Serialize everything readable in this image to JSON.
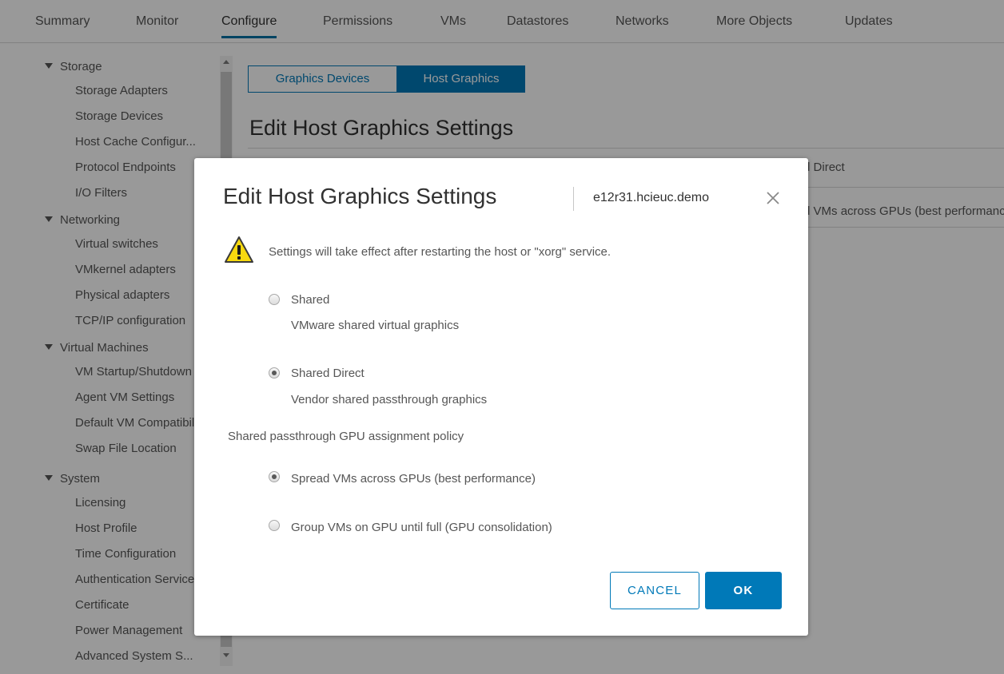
{
  "top_tabs": [
    {
      "label": "Summary"
    },
    {
      "label": "Monitor"
    },
    {
      "label": "Configure"
    },
    {
      "label": "Permissions"
    },
    {
      "label": "VMs"
    },
    {
      "label": "Datastores"
    },
    {
      "label": "Networks"
    },
    {
      "label": "More Objects"
    },
    {
      "label": "Updates"
    }
  ],
  "sidebar": {
    "groups": [
      {
        "label": "Storage",
        "items": [
          "Storage Adapters",
          "Storage Devices",
          "Host Cache Configur...",
          "Protocol Endpoints",
          "I/O Filters"
        ]
      },
      {
        "label": "Networking",
        "items": [
          "Virtual switches",
          "VMkernel adapters",
          "Physical adapters",
          "TCP/IP configuration"
        ]
      },
      {
        "label": "Virtual Machines",
        "items": [
          "VM Startup/Shutdown",
          "Agent VM Settings",
          "Default VM Compatibility",
          "Swap File Location"
        ]
      },
      {
        "label": "System",
        "items": [
          "Licensing",
          "Host Profile",
          "Time Configuration",
          "Authentication Services",
          "Certificate",
          "Power Management",
          "Advanced System S..."
        ]
      }
    ]
  },
  "segmented": {
    "graphics_devices": "Graphics Devices",
    "host_graphics": "Host Graphics"
  },
  "background": {
    "heading": "Edit Host Graphics Settings",
    "row1_value": "Shared Direct",
    "row2_value": "Spread VMs across GPUs (best performance)"
  },
  "dialog": {
    "title": "Edit Host Graphics Settings",
    "host": "e12r31.hcieuc.demo",
    "warning": "Settings will take effect after restarting the host or \"xorg\" service.",
    "graphics_type": [
      {
        "label": "Shared",
        "description": "VMware shared virtual graphics",
        "checked": false
      },
      {
        "label": "Shared Direct",
        "description": "Vendor shared passthrough graphics",
        "checked": true
      }
    ],
    "policy_title": "Shared passthrough GPU assignment policy",
    "policy_options": [
      {
        "label": "Spread VMs across GPUs (best performance)",
        "checked": true
      },
      {
        "label": "Group VMs on GPU until full (GPU consolidation)",
        "checked": false
      }
    ],
    "cancel_label": "CANCEL",
    "ok_label": "OK"
  },
  "icons": {
    "warning": "warning-triangle-icon",
    "close": "close-icon",
    "caret": "caret-down-icon"
  },
  "colors": {
    "accent": "#0079b8",
    "tab_underline": "#0072a3",
    "warning_fill": "#f8d90f"
  }
}
